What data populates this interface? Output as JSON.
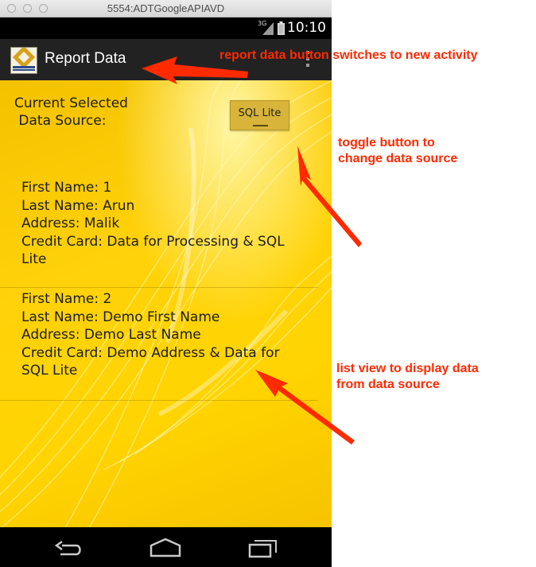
{
  "window": {
    "title": "5554:ADTGoogleAPIAVD"
  },
  "status_bar": {
    "network": "3G",
    "time": "10:10"
  },
  "action_bar": {
    "title": "Report Data",
    "logo_text": "San José State University"
  },
  "data_source": {
    "label": "Current Selected\n Data Source:",
    "toggle_label": "SQL Lite"
  },
  "records": [
    {
      "first_name": "First Name: 1",
      "last_name": "Last Name: Arun",
      "address": "Address: Malik",
      "credit_card": "Credit Card: Data for Processing & SQL Lite"
    },
    {
      "first_name": "First Name: 2",
      "last_name": "Last Name: Demo First Name",
      "address": "Address: Demo Last Name",
      "credit_card": "Credit Card: Demo Address & Data for SQL Lite"
    }
  ],
  "annotations": {
    "report": "report data button switches to new activity",
    "toggle": "toggle button to\nchange data source",
    "list": "list view to display data\nfrom data source"
  },
  "colors": {
    "annotation": "#ff2a00",
    "background": "#ffd400",
    "action_bar": "#222222"
  }
}
